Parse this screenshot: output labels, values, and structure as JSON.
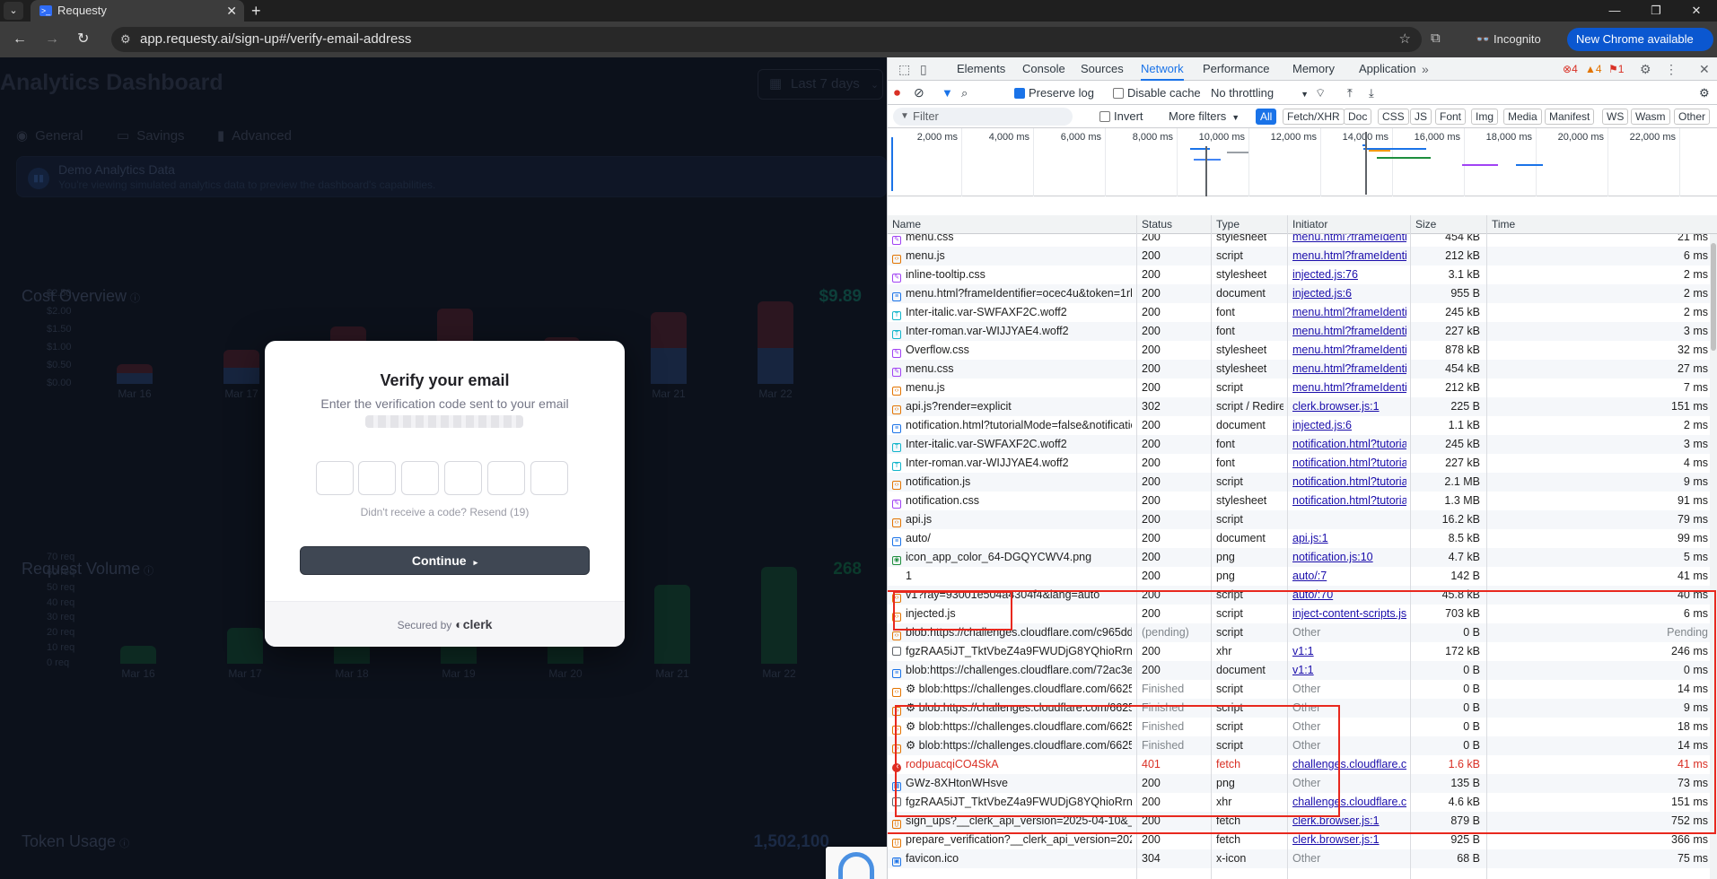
{
  "browser": {
    "tab_title": "Requesty",
    "url": "app.requesty.ai/sign-up#/verify-email-address",
    "incognito_label": "Incognito",
    "update_label": "New Chrome available"
  },
  "dashboard": {
    "title": "Analytics Dashboard",
    "date_range": "Last 7 days",
    "tabs": [
      "General",
      "Savings",
      "Advanced"
    ],
    "banner_title": "Demo Analytics Data",
    "banner_text": "You're viewing simulated analytics data to preview the dashboard's capabilities.",
    "cost_title": "Cost Overview",
    "cost_value": "$9.89",
    "request_title": "Request Volume",
    "request_value": "268",
    "token_title": "Token Usage",
    "token_value": "1,502,100",
    "colors": {
      "cost_value": "#0d3f3a",
      "request_value": "#0b3a2c",
      "token_value": "#1b2a45"
    }
  },
  "chart_data": [
    {
      "type": "bar",
      "title": "Cost Overview",
      "categories": [
        "Mar 16",
        "Mar 17",
        "Mar 18",
        "Mar 19",
        "Mar 20",
        "Mar 21",
        "Mar 22"
      ],
      "y_ticks": [
        "$2.50",
        "$2.00",
        "$1.50",
        "$1.00",
        "$0.50",
        "$0.00"
      ],
      "ylim": [
        0,
        2.5
      ],
      "series": [
        {
          "values": [
            0.3,
            0.45,
            0.9,
            1.1,
            0.7,
            1.0,
            1.0
          ]
        },
        {
          "values": [
            0.25,
            0.5,
            0.7,
            1.0,
            0.6,
            1.0,
            1.3
          ]
        }
      ],
      "colors": [
        "#17253f",
        "#2c1620"
      ]
    },
    {
      "type": "bar",
      "title": "Request Volume",
      "categories": [
        "Mar 16",
        "Mar 17",
        "Mar 18",
        "Mar 19",
        "Mar 20",
        "Mar 21",
        "Mar 22"
      ],
      "y_ticks": [
        "70 req",
        "60 req",
        "50 req",
        "40 req",
        "30 req",
        "20 req",
        "10 req",
        "0 req"
      ],
      "ylim": [
        0,
        70
      ],
      "values": [
        12,
        24,
        36,
        42,
        38,
        52,
        64
      ],
      "colors": [
        "#0d2a22"
      ]
    }
  ],
  "modal": {
    "title": "Verify your email",
    "subtitle": "Enter the verification code sent to your email",
    "resend": "Didn't receive a code? Resend (19)",
    "continue_label": "Continue",
    "secured_by": "Secured by",
    "brand": "clerk"
  },
  "devtools": {
    "tabs": [
      "Elements",
      "Console",
      "Sources",
      "Network",
      "Performance",
      "Memory",
      "Application"
    ],
    "active_tab": "Network",
    "errors": "4",
    "warnings": "4",
    "issues": "1",
    "preserve_log": "Preserve log",
    "disable_cache": "Disable cache",
    "throttling": "No throttling",
    "filter_placeholder": "Filter",
    "invert": "Invert",
    "more_filters": "More filters",
    "type_filters": [
      "All",
      "Fetch/XHR",
      "Doc",
      "CSS",
      "JS",
      "Font",
      "Img",
      "Media",
      "Manifest",
      "WS",
      "Wasm",
      "Other"
    ],
    "timeline_ticks": [
      "2,000 ms",
      "4,000 ms",
      "6,000 ms",
      "8,000 ms",
      "10,000 ms",
      "12,000 ms",
      "14,000 ms",
      "16,000 ms",
      "18,000 ms",
      "20,000 ms",
      "22,000 ms"
    ],
    "columns": [
      "Name",
      "Status",
      "Type",
      "Initiator",
      "Size",
      "Time"
    ],
    "rows": [
      {
        "name": "menu.css",
        "status": "200",
        "type": "stylesheet",
        "initiator": "menu.html?frameIdentifier=o",
        "size": "454 kB",
        "time": "21 ms",
        "icon": "css"
      },
      {
        "name": "menu.js",
        "status": "200",
        "type": "script",
        "initiator": "menu.html?frameIdentifier=o",
        "size": "212 kB",
        "time": "6 ms",
        "icon": "js"
      },
      {
        "name": "inline-tooltip.css",
        "status": "200",
        "type": "stylesheet",
        "initiator": "injected.js:76",
        "size": "3.1 kB",
        "time": "2 ms",
        "icon": "css"
      },
      {
        "name": "menu.html?frameIdentifier=ocec4u&token=1rh4tcv...",
        "status": "200",
        "type": "document",
        "initiator": "injected.js:6",
        "size": "955 B",
        "time": "2 ms",
        "icon": "doc"
      },
      {
        "name": "Inter-italic.var-SWFAXF2C.woff2",
        "status": "200",
        "type": "font",
        "initiator": "menu.html?frameIdentifier=o",
        "size": "245 kB",
        "time": "2 ms",
        "icon": "font"
      },
      {
        "name": "Inter-roman.var-WIJJYAE4.woff2",
        "status": "200",
        "type": "font",
        "initiator": "menu.html?frameIdentifier=o",
        "size": "227 kB",
        "time": "3 ms",
        "icon": "font"
      },
      {
        "name": "Overflow.css",
        "status": "200",
        "type": "stylesheet",
        "initiator": "menu.html?frameIdentifier=o",
        "size": "878 kB",
        "time": "32 ms",
        "icon": "css"
      },
      {
        "name": "menu.css",
        "status": "200",
        "type": "stylesheet",
        "initiator": "menu.html?frameIdentifier=o",
        "size": "454 kB",
        "time": "27 ms",
        "icon": "css"
      },
      {
        "name": "menu.js",
        "status": "200",
        "type": "script",
        "initiator": "menu.html?frameIdentifier=o",
        "size": "212 kB",
        "time": "7 ms",
        "icon": "js"
      },
      {
        "name": "api.js?render=explicit",
        "status": "302",
        "type": "script / Redirect",
        "initiator": "clerk.browser.js:1",
        "size": "225 B",
        "time": "151 ms",
        "icon": "js"
      },
      {
        "name": "notification.html?tutorialMode=false&notificationId...",
        "status": "200",
        "type": "document",
        "initiator": "injected.js:6",
        "size": "1.1 kB",
        "time": "2 ms",
        "icon": "doc"
      },
      {
        "name": "Inter-italic.var-SWFAXF2C.woff2",
        "status": "200",
        "type": "font",
        "initiator": "notification.html?tutorialMo",
        "size": "245 kB",
        "time": "3 ms",
        "icon": "font"
      },
      {
        "name": "Inter-roman.var-WIJJYAE4.woff2",
        "status": "200",
        "type": "font",
        "initiator": "notification.html?tutorialMo",
        "size": "227 kB",
        "time": "4 ms",
        "icon": "font"
      },
      {
        "name": "notification.js",
        "status": "200",
        "type": "script",
        "initiator": "notification.html?tutorialMo",
        "size": "2.1 MB",
        "time": "9 ms",
        "icon": "js"
      },
      {
        "name": "notification.css",
        "status": "200",
        "type": "stylesheet",
        "initiator": "notification.html?tutorialMo",
        "size": "1.3 MB",
        "time": "91 ms",
        "icon": "css"
      },
      {
        "name": "api.js",
        "status": "200",
        "type": "script",
        "initiator": "",
        "size": "16.2 kB",
        "time": "79 ms",
        "icon": "js"
      },
      {
        "name": "auto/",
        "status": "200",
        "type": "document",
        "initiator": "api.js:1",
        "size": "8.5 kB",
        "time": "99 ms",
        "icon": "doc"
      },
      {
        "name": "icon_app_color_64-DGQYCWV4.png",
        "status": "200",
        "type": "png",
        "initiator": "notification.js:10",
        "size": "4.7 kB",
        "time": "5 ms",
        "icon": "img"
      },
      {
        "name": "1",
        "status": "200",
        "type": "png",
        "initiator": "auto/:7",
        "size": "142 B",
        "time": "41 ms",
        "icon": "none"
      },
      {
        "name": "v1?ray=93001e504a4304f4&lang=auto",
        "status": "200",
        "type": "script",
        "initiator": "auto/:70",
        "size": "45.8 kB",
        "time": "40 ms",
        "icon": "js"
      },
      {
        "name": "injected.js",
        "status": "200",
        "type": "script",
        "initiator": "inject-content-scripts.js:5",
        "size": "703 kB",
        "time": "6 ms",
        "icon": "js"
      },
      {
        "name": "blob:https://challenges.cloudflare.com/c965dd2b-9...",
        "status": "(pending)",
        "type": "script",
        "initiator": "Other",
        "size": "0 B",
        "time": "Pending",
        "icon": "js"
      },
      {
        "name": "fgzRAA5iJT_TktVbeZ4a9FWUDjG8YQhioRrnPQO6Cc...",
        "status": "200",
        "type": "xhr",
        "initiator": "v1:1",
        "size": "172 kB",
        "time": "246 ms",
        "icon": "file"
      },
      {
        "name": "blob:https://challenges.cloudflare.com/72ac3e23-59...",
        "status": "200",
        "type": "document",
        "initiator": "v1:1",
        "size": "0 B",
        "time": "0 ms",
        "icon": "doc"
      },
      {
        "name": "⚙ blob:https://challenges.cloudflare.com/6625afc2-...",
        "status": "Finished",
        "type": "script",
        "initiator": "Other",
        "size": "0 B",
        "time": "14 ms",
        "icon": "js"
      },
      {
        "name": "⚙ blob:https://challenges.cloudflare.com/6625afc2-...",
        "status": "Finished",
        "type": "script",
        "initiator": "Other",
        "size": "0 B",
        "time": "9 ms",
        "icon": "js"
      },
      {
        "name": "⚙ blob:https://challenges.cloudflare.com/6625afc2-...",
        "status": "Finished",
        "type": "script",
        "initiator": "Other",
        "size": "0 B",
        "time": "18 ms",
        "icon": "js"
      },
      {
        "name": "⚙ blob:https://challenges.cloudflare.com/6625afc2-...",
        "status": "Finished",
        "type": "script",
        "initiator": "Other",
        "size": "0 B",
        "time": "14 ms",
        "icon": "js"
      },
      {
        "name": "rodpuacqiCO4SkA",
        "status": "401",
        "type": "fetch",
        "initiator": "challenges.cloudflare.com...",
        "size": "1.6 kB",
        "time": "41 ms",
        "icon": "err"
      },
      {
        "name": "GWz-8XHtonWHsve",
        "status": "200",
        "type": "png",
        "initiator": "Other",
        "size": "135 B",
        "time": "73 ms",
        "icon": "img2"
      },
      {
        "name": "fgzRAA5iJT_TktVbeZ4a9FWUDjG8YQhioRrnPQO6Cc...",
        "status": "200",
        "type": "xhr",
        "initiator": "challenges.cloudflare.com...",
        "size": "4.6 kB",
        "time": "151 ms",
        "icon": "file"
      },
      {
        "name": "sign_ups?__clerk_api_version=2025-04-10&_clerk_js...",
        "status": "200",
        "type": "fetch",
        "initiator": "clerk.browser.js:1",
        "size": "879 B",
        "time": "752 ms",
        "icon": "fetch"
      },
      {
        "name": "prepare_verification?__clerk_api_version=2025-04-1...",
        "status": "200",
        "type": "fetch",
        "initiator": "clerk.browser.js:1",
        "size": "925 B",
        "time": "366 ms",
        "icon": "fetch"
      },
      {
        "name": "favicon.ico",
        "status": "304",
        "type": "x-icon",
        "initiator": "Other",
        "size": "68 B",
        "time": "75 ms",
        "icon": "ico"
      }
    ]
  }
}
